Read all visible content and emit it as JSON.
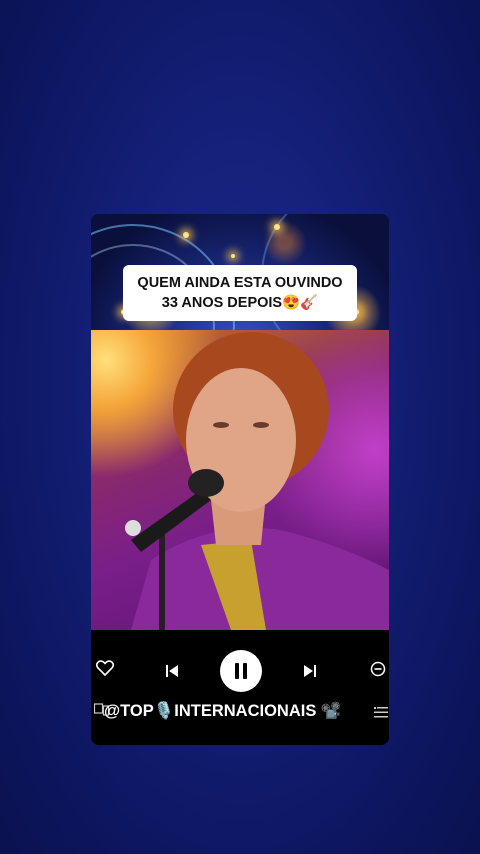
{
  "caption": {
    "line1": "QUEM AINDA ESTA OUVINDO",
    "line2": "33 ANOS DEPOIS😍🎸"
  },
  "player": {
    "like_icon": "heart-icon",
    "prev_icon": "skip-previous-icon",
    "pause_icon": "pause-icon",
    "next_icon": "skip-next-icon",
    "remove_icon": "minus-circle-icon",
    "device_icon": "device-icon",
    "queue_icon": "queue-list-icon"
  },
  "handle": {
    "text": "@TOP🎙️INTERNACIONAIS 📽️"
  },
  "colors": {
    "background": "#142078",
    "card": "#000000",
    "caption_bg": "#ffffff",
    "suit": "#8a2a9a"
  }
}
